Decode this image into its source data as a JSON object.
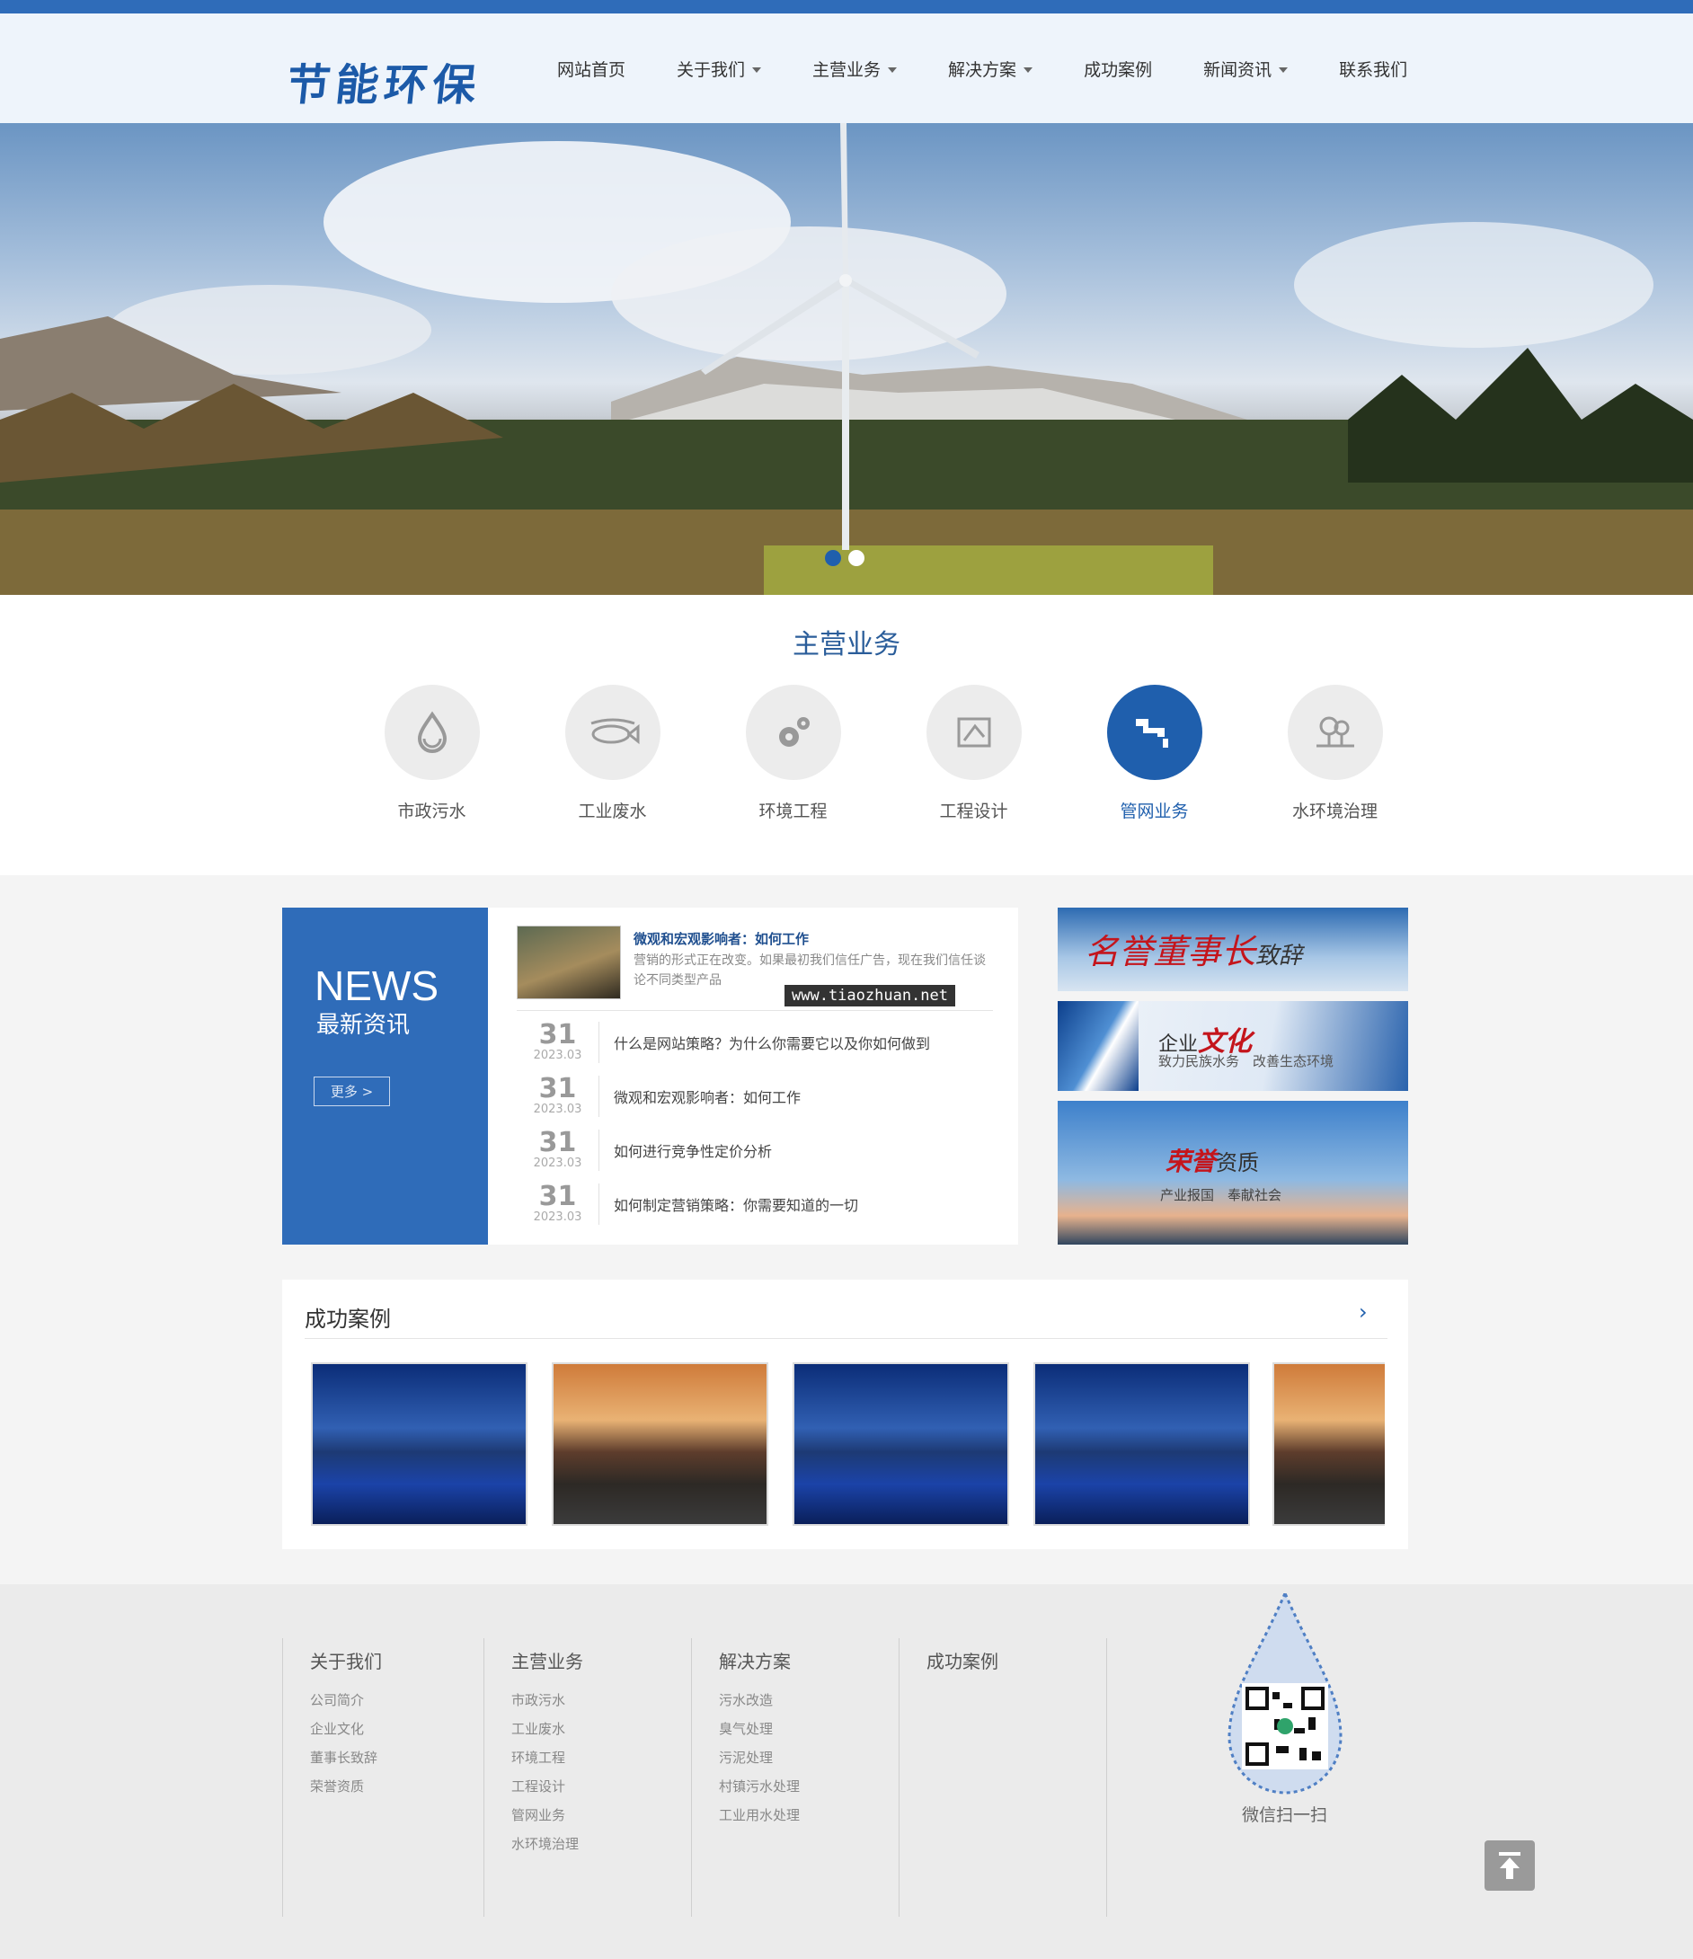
{
  "header": {
    "logo": "节能环保",
    "nav": [
      {
        "label": "网站首页",
        "dropdown": false
      },
      {
        "label": "关于我们",
        "dropdown": true
      },
      {
        "label": "主营业务",
        "dropdown": true
      },
      {
        "label": "解决方案",
        "dropdown": true
      },
      {
        "label": "成功案例",
        "dropdown": false
      },
      {
        "label": "新闻资讯",
        "dropdown": true
      },
      {
        "label": "联系我们",
        "dropdown": false
      }
    ]
  },
  "business": {
    "title": "主营业务",
    "items": [
      {
        "label": "市政污水",
        "icon": "water-drop-icon",
        "active": false
      },
      {
        "label": "工业废水",
        "icon": "industrial-fish-icon",
        "active": false
      },
      {
        "label": "环境工程",
        "icon": "gears-icon",
        "active": false
      },
      {
        "label": "工程设计",
        "icon": "drafting-icon",
        "active": false
      },
      {
        "label": "管网业务",
        "icon": "pipe-faucet-icon",
        "active": true
      },
      {
        "label": "水环境治理",
        "icon": "tree-landscape-icon",
        "active": false
      }
    ]
  },
  "news": {
    "en_title": "NEWS",
    "cn_title": "最新资讯",
    "more": "更多 >",
    "featured": {
      "title": "微观和宏观影响者：如何工作",
      "desc": "营销的形式正在改变。如果最初我们信任广告，现在我们信任谈论不同类型产品",
      "watermark": "www.tiaozhuan.net"
    },
    "items": [
      {
        "day": "31",
        "ym": "2023.03",
        "title": "什么是网站策略？为什么你需要它以及你如何做到"
      },
      {
        "day": "31",
        "ym": "2023.03",
        "title": "微观和宏观影响者：如何工作"
      },
      {
        "day": "31",
        "ym": "2023.03",
        "title": "如何进行竞争性定价分析"
      },
      {
        "day": "31",
        "ym": "2023.03",
        "title": "如何制定营销策略：你需要知道的一切"
      }
    ]
  },
  "ads": {
    "ad1": {
      "title": "名誉董事长",
      "small": "致辞"
    },
    "ad2": {
      "lead": "企业",
      "title": "文化",
      "sub": "致力民族水务　改善生态环境"
    },
    "ad3": {
      "title": "荣誉",
      "tail": "资质",
      "sub": "产业报国　奉献社会"
    }
  },
  "cases": {
    "title": "成功案例",
    "arrow": "›"
  },
  "footer": {
    "columns": [
      {
        "title": "关于我们",
        "links": [
          "公司简介",
          "企业文化",
          "董事长致辞",
          "荣誉资质"
        ]
      },
      {
        "title": "主营业务",
        "links": [
          "市政污水",
          "工业废水",
          "环境工程",
          "工程设计",
          "管网业务",
          "水环境治理"
        ]
      },
      {
        "title": "解决方案",
        "links": [
          "污水改造",
          "臭气处理",
          "污泥处理",
          "村镇污水处理",
          "工业用水处理"
        ]
      },
      {
        "title": "成功案例",
        "links": []
      }
    ],
    "qr_label": "微信扫一扫"
  },
  "colors": {
    "brand": "#2f6cb9",
    "active": "#1f5fad"
  }
}
